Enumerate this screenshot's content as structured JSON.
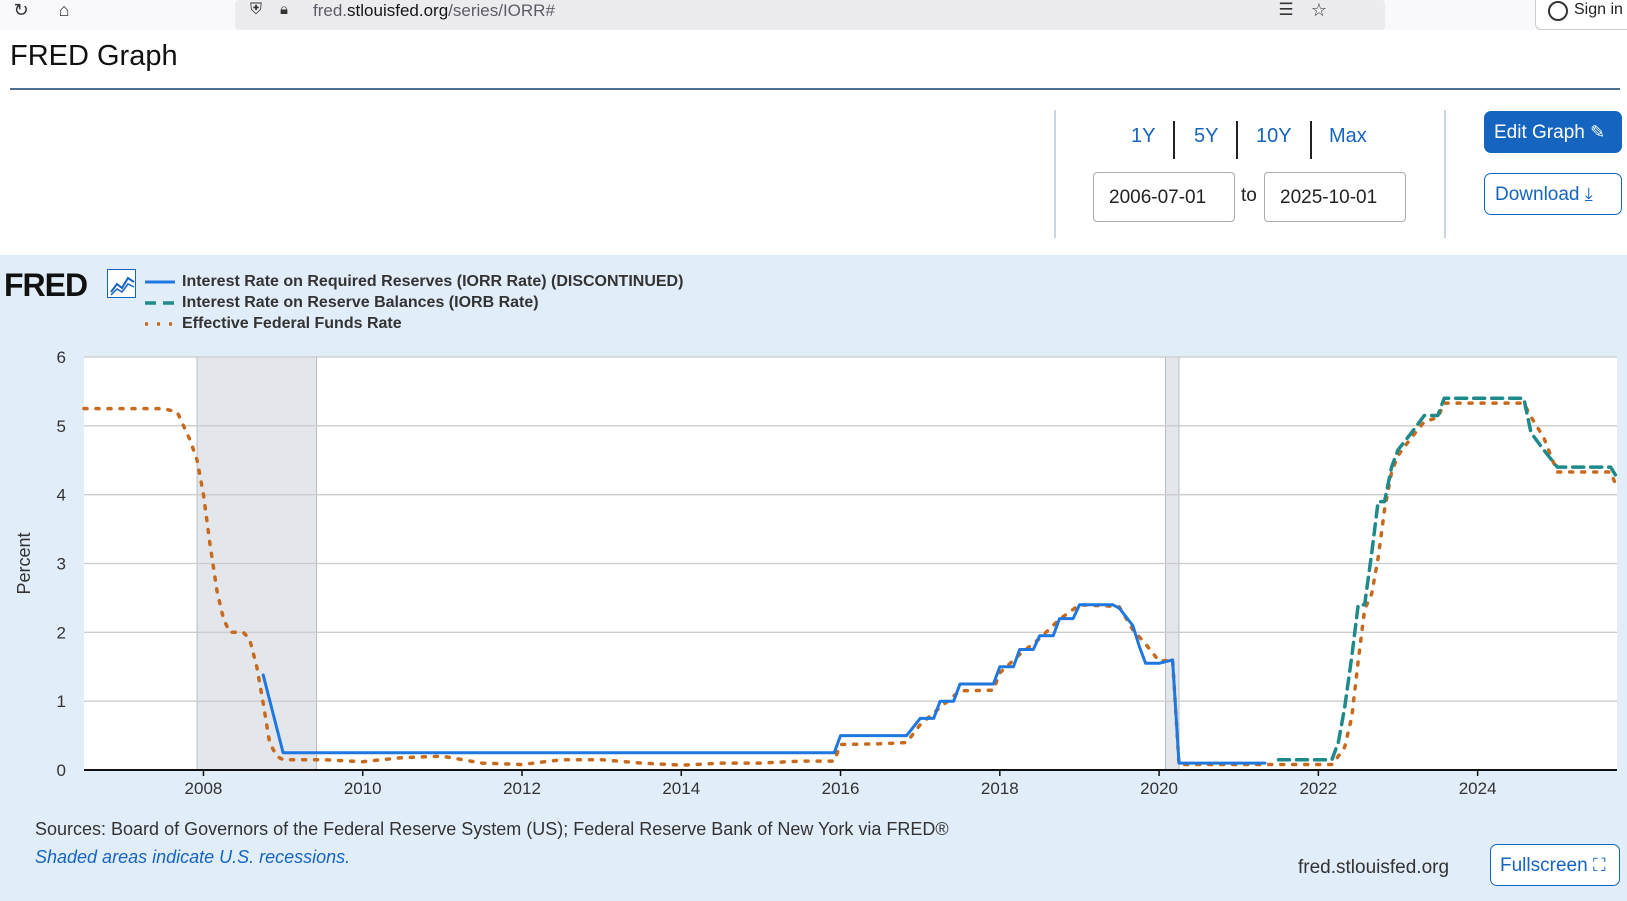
{
  "browser": {
    "url_prefix": "fred.",
    "url_domain": "stlouisfed.org",
    "url_path": "/series/IORR#",
    "sign_in": "Sign in"
  },
  "header": {
    "title": "FRED Graph"
  },
  "controls": {
    "ranges": [
      "1Y",
      "5Y",
      "10Y",
      "Max"
    ],
    "start_date": "2006-07-01",
    "to_label": "to",
    "end_date": "2025-10-01",
    "edit_label": "Edit Graph",
    "download_label": "Download"
  },
  "footer": {
    "sources": "Sources: Board of Governors of the Federal Reserve System (US); Federal Reserve Bank of New York via FRED®",
    "recession_note": "Shaded areas indicate U.S. recessions.",
    "site": "fred.stlouisfed.org",
    "fullscreen_label": "Fullscreen"
  },
  "logo": {
    "text": "FRED"
  },
  "colors": {
    "iorr": "#1f77e0",
    "iorb": "#1f8a8a",
    "effr": "#c76a1e",
    "recession": "#e3e6ea",
    "accent": "#1565c0"
  },
  "chart_data": {
    "type": "line",
    "ylabel": "Percent",
    "xlim": [
      2006.5,
      2025.75
    ],
    "ylim": [
      0,
      6
    ],
    "yticks": [
      0,
      1,
      2,
      3,
      4,
      5,
      6
    ],
    "xticks": [
      2008,
      2010,
      2012,
      2014,
      2016,
      2018,
      2020,
      2022,
      2024
    ],
    "grid": true,
    "legend_position": "top-left",
    "recessions": [
      [
        2007.92,
        2009.42
      ],
      [
        2020.08,
        2020.25
      ]
    ],
    "series": [
      {
        "name": "Interest Rate on Required Reserves (IORR Rate) (DISCONTINUED)",
        "style": "solid",
        "x": [
          2008.75,
          2009.0,
          2015.92,
          2016.0,
          2016.83,
          2017.0,
          2017.17,
          2017.25,
          2017.42,
          2017.5,
          2017.92,
          2018.0,
          2018.17,
          2018.25,
          2018.42,
          2018.5,
          2018.67,
          2018.75,
          2018.92,
          2019.0,
          2019.42,
          2019.5,
          2019.67,
          2019.75,
          2019.83,
          2020.0,
          2020.17,
          2020.25,
          2021.33
        ],
        "y": [
          1.38,
          0.25,
          0.25,
          0.5,
          0.5,
          0.75,
          0.75,
          1.0,
          1.0,
          1.25,
          1.25,
          1.5,
          1.5,
          1.75,
          1.75,
          1.95,
          1.95,
          2.2,
          2.2,
          2.4,
          2.4,
          2.35,
          2.1,
          1.8,
          1.55,
          1.55,
          1.6,
          0.1,
          0.1
        ]
      },
      {
        "name": "Interest Rate on Reserve Balances (IORB Rate)",
        "style": "dashed",
        "x": [
          2021.5,
          2021.58,
          2022.17,
          2022.25,
          2022.33,
          2022.42,
          2022.5,
          2022.58,
          2022.67,
          2022.75,
          2022.83,
          2022.92,
          2023.0,
          2023.17,
          2023.33,
          2023.5,
          2023.58,
          2024.58,
          2024.67,
          2024.83,
          2025.0,
          2025.67,
          2025.75
        ],
        "y": [
          0.15,
          0.15,
          0.15,
          0.4,
          0.9,
          1.65,
          2.4,
          2.4,
          3.15,
          3.9,
          3.9,
          4.4,
          4.65,
          4.9,
          5.15,
          5.15,
          5.4,
          5.4,
          4.9,
          4.65,
          4.4,
          4.4,
          4.25
        ]
      },
      {
        "name": "Effective Federal Funds Rate",
        "style": "dotted",
        "x": [
          2006.5,
          2006.75,
          2007.0,
          2007.25,
          2007.5,
          2007.67,
          2007.75,
          2007.83,
          2007.92,
          2008.0,
          2008.08,
          2008.17,
          2008.25,
          2008.33,
          2008.42,
          2008.5,
          2008.58,
          2008.67,
          2008.75,
          2008.83,
          2008.92,
          2009.0,
          2009.5,
          2010.0,
          2010.5,
          2011.0,
          2011.5,
          2012.0,
          2012.5,
          2013.0,
          2013.5,
          2014.0,
          2014.5,
          2015.0,
          2015.5,
          2015.92,
          2016.0,
          2016.5,
          2016.83,
          2017.0,
          2017.25,
          2017.5,
          2017.92,
          2018.0,
          2018.25,
          2018.5,
          2018.75,
          2019.0,
          2019.42,
          2019.5,
          2019.67,
          2019.83,
          2020.0,
          2020.17,
          2020.25,
          2021.0,
          2021.5,
          2022.0,
          2022.17,
          2022.25,
          2022.33,
          2022.42,
          2022.5,
          2022.58,
          2022.67,
          2022.75,
          2022.83,
          2022.92,
          2023.0,
          2023.17,
          2023.33,
          2023.5,
          2023.58,
          2024.58,
          2024.67,
          2024.83,
          2025.0,
          2025.67,
          2025.75
        ],
        "y": [
          5.25,
          5.25,
          5.25,
          5.25,
          5.25,
          5.2,
          5.0,
          4.8,
          4.5,
          4.0,
          3.3,
          2.6,
          2.2,
          2.0,
          2.0,
          2.0,
          1.9,
          1.5,
          0.97,
          0.4,
          0.2,
          0.15,
          0.15,
          0.12,
          0.18,
          0.2,
          0.1,
          0.08,
          0.15,
          0.15,
          0.1,
          0.07,
          0.1,
          0.1,
          0.13,
          0.13,
          0.37,
          0.38,
          0.4,
          0.66,
          0.91,
          1.15,
          1.16,
          1.41,
          1.68,
          1.91,
          2.19,
          2.4,
          2.38,
          2.37,
          2.04,
          1.83,
          1.58,
          1.6,
          0.08,
          0.08,
          0.08,
          0.08,
          0.08,
          0.2,
          0.33,
          0.77,
          1.58,
          2.33,
          2.56,
          3.08,
          3.78,
          4.33,
          4.57,
          4.83,
          5.06,
          5.12,
          5.33,
          5.33,
          5.13,
          4.83,
          4.33,
          4.33,
          4.1
        ]
      }
    ]
  }
}
